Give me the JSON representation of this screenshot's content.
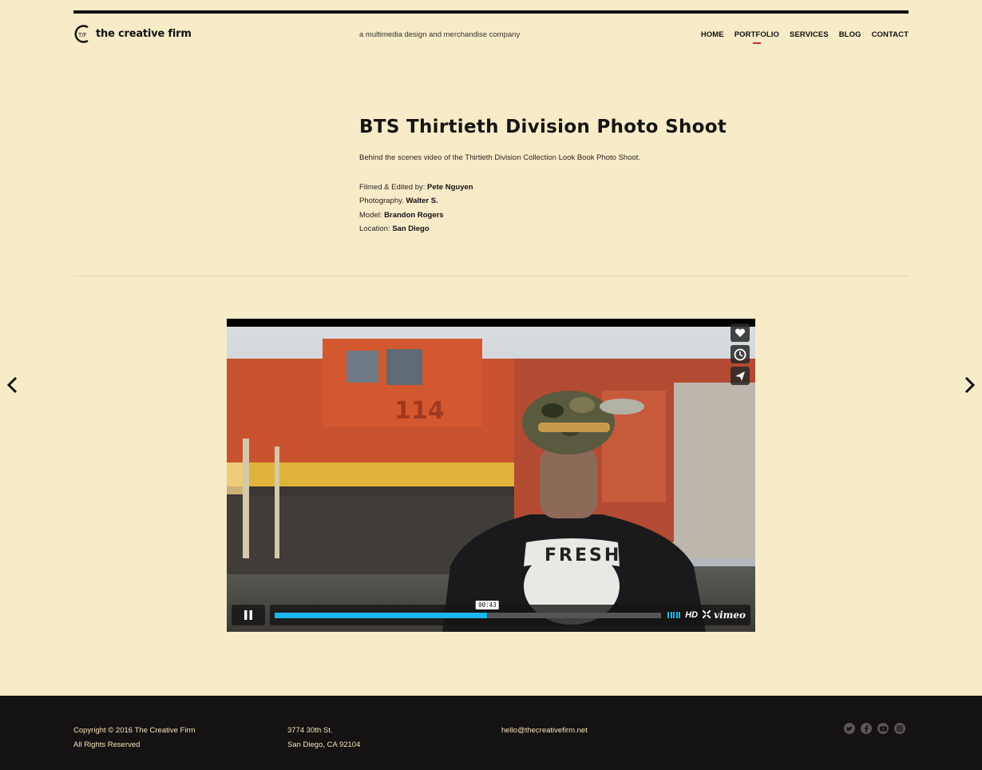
{
  "header": {
    "logo_text": "the creative firm",
    "tagline": "a multimedia design and merchandise company",
    "nav": [
      {
        "label": "HOME",
        "active": false
      },
      {
        "label": "PORTFOLIO",
        "active": true
      },
      {
        "label": "SERVICES",
        "active": false
      },
      {
        "label": "BLOG",
        "active": false
      },
      {
        "label": "CONTACT",
        "active": false
      }
    ]
  },
  "project": {
    "title": "BTS Thirtieth Division Photo Shoot",
    "description": "Behind the scenes video of the Thirtieth Division Collection Look Book Photo Shoot.",
    "credits": [
      {
        "label": "Filmed & Edited by:",
        "value": "Pete Nguyen"
      },
      {
        "label": "Photography.",
        "value": "Walter S."
      },
      {
        "label": "Model:",
        "value": "Brandon Rogers"
      },
      {
        "label": "Location:",
        "value": "San Diego"
      }
    ]
  },
  "player": {
    "timecode": "00:43",
    "progress": 0.55,
    "hd_label": "HD",
    "brand": "vimeo",
    "shirt_text": "FRESH",
    "train_number": "114",
    "side_buttons": [
      "heart-icon",
      "clock-icon",
      "send-icon"
    ],
    "accent": "#1ab7ea"
  },
  "footer": {
    "copyright": "Copyright © 2016 The Creative Firm",
    "rights": "All Rights Reserved",
    "address_line1": "3774 30th St.",
    "address_line2": "San Diego, CA 92104",
    "email": "hello@thecreativefirm.net",
    "social": [
      "twitter-icon",
      "facebook-icon",
      "youtube-icon",
      "instagram-icon"
    ]
  },
  "colors": {
    "background": "#f8ebc8",
    "footer_bg": "#141213",
    "footer_text": "#f5e4b7",
    "nav_active": "#d3262b"
  }
}
